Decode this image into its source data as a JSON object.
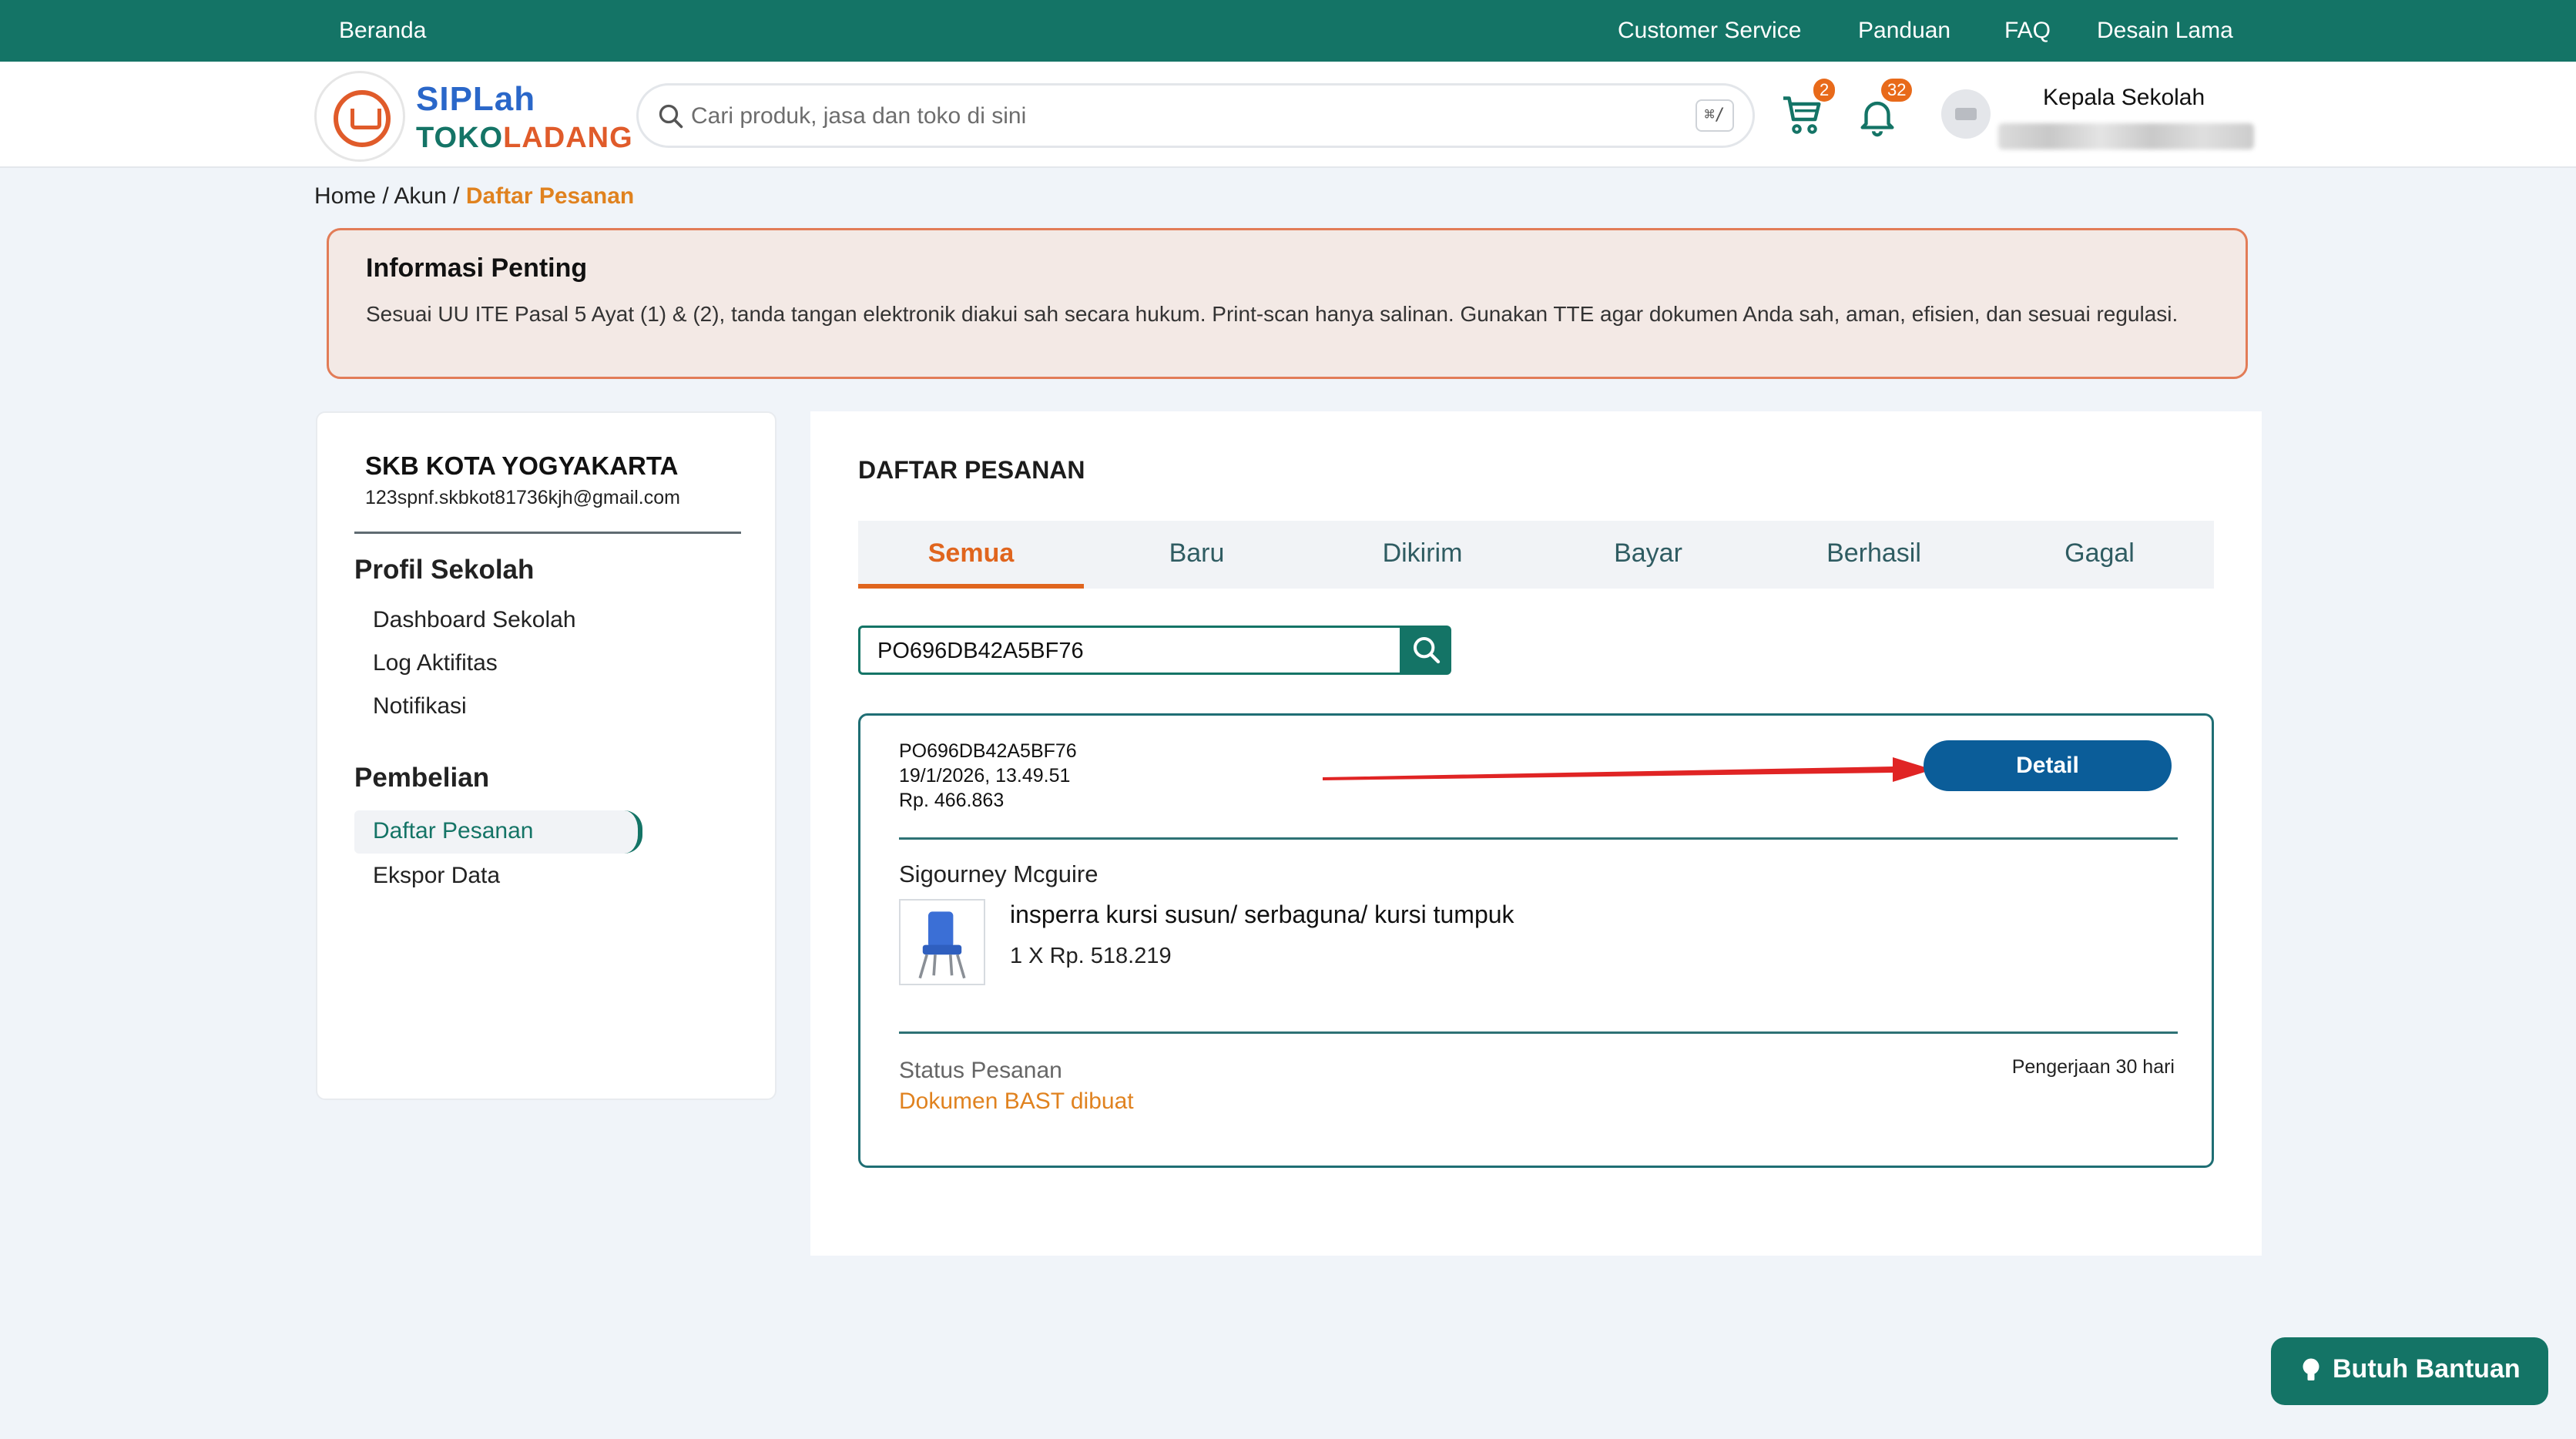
{
  "topbar": {
    "home": "Beranda",
    "links": [
      "Customer Service",
      "Panduan",
      "FAQ",
      "Desain Lama"
    ]
  },
  "header": {
    "logo_line1": "SIPLah",
    "logo_line2_a": "TOKO",
    "logo_line2_b": "LADANG",
    "search_placeholder": "Cari produk, jasa dan toko di sini",
    "search_shortcut": "⌘/",
    "cart_count": "2",
    "notif_count": "32",
    "user_role": "Kepala Sekolah"
  },
  "breadcrumb": {
    "home": "Home",
    "account": "Akun",
    "current": "Daftar Pesanan",
    "separator": "/"
  },
  "info": {
    "title": "Informasi Penting",
    "body": "Sesuai UU ITE Pasal 5 Ayat (1) & (2), tanda tangan elektronik diakui sah secara hukum. Print-scan hanya salinan. Gunakan TTE agar dokumen Anda sah, aman, efisien, dan sesuai regulasi."
  },
  "sidebar": {
    "school_name": "SKB KOTA YOGYAKARTA",
    "school_email": "123spnf.skbkot81736kjh@gmail.com",
    "profile_heading": "Profil Sekolah",
    "profile_items": [
      "Dashboard Sekolah",
      "Log Aktifitas",
      "Notifikasi"
    ],
    "purchase_heading": "Pembelian",
    "purchase_items": [
      "Daftar Pesanan",
      "Ekspor Data"
    ]
  },
  "main": {
    "title": "DAFTAR PESANAN",
    "tabs": [
      "Semua",
      "Baru",
      "Dikirim",
      "Bayar",
      "Berhasil",
      "Gagal"
    ],
    "active_tab": "Semua",
    "search_value": "PO696DB42A5BF76"
  },
  "order": {
    "po_number": "PO696DB42A5BF76",
    "datetime": "19/1/2026, 13.49.51",
    "total": "Rp. 466.863",
    "detail_label": "Detail",
    "seller": "Sigourney Mcguire",
    "product_name": "insperra kursi susun/ serbaguna/ kursi tumpuk",
    "product_qty_price": "1 X Rp. 518.219",
    "status_label": "Status Pesanan",
    "status_value": "Dokumen BAST dibuat",
    "duration": "Pengerjaan 30 hari"
  },
  "help": {
    "label": "Butuh Bantuan"
  },
  "colors": {
    "primary": "#147466",
    "accent": "#e0651e",
    "detail_button": "#0b5d99",
    "annotation_arrow": "#e02424"
  }
}
